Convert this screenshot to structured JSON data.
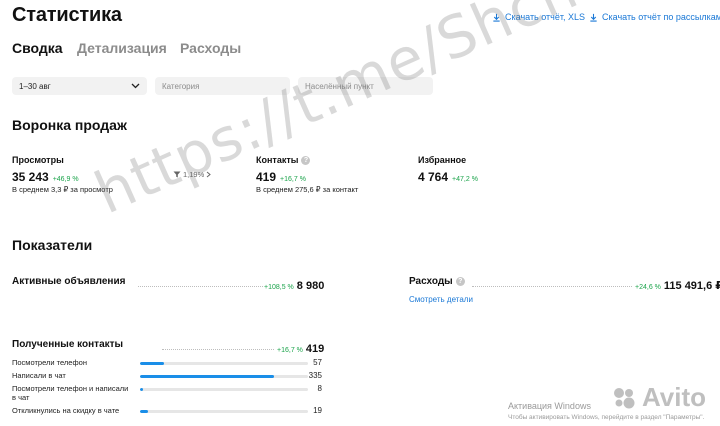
{
  "header": {
    "title": "Статистика",
    "download_report": "Скачать отчёт, XLS",
    "download_mailing_report": "Скачать отчёт по рассылкам, XLS"
  },
  "tabs": [
    {
      "label": "Сводка",
      "active": true
    },
    {
      "label": "Детализация",
      "active": false
    },
    {
      "label": "Расходы",
      "active": false
    }
  ],
  "filters": {
    "period": "1–30 авг",
    "category_placeholder": "Категория",
    "city_placeholder": "Населённый пункт"
  },
  "funnel": {
    "title": "Воронка продаж",
    "views": {
      "label": "Просмотры",
      "value": "35 243",
      "delta": "+46,9 %",
      "sub": "В среднем 3,3 ₽ за просмотр"
    },
    "conversion": "1,19%",
    "contacts": {
      "label": "Контакты",
      "value": "419",
      "delta": "+16,7 %",
      "sub": "В среднем 275,6 ₽ за контакт"
    },
    "favorites": {
      "label": "Избранное",
      "value": "4 764",
      "delta": "+47,2 %"
    }
  },
  "indicators": {
    "title": "Показатели",
    "active_ads": {
      "label": "Активные объявления",
      "delta": "+108,5 %",
      "value": "8 980"
    },
    "expenses": {
      "label": "Расходы",
      "delta": "+24,6 %",
      "value": "115 491,6 ₽",
      "link": "Смотреть детали"
    },
    "received_contacts": {
      "label": "Полученные контакты",
      "delta": "+16,7 %",
      "value": "419",
      "rows": [
        {
          "label": "Посмотрели телефон",
          "value": "57",
          "fraction": 0.14
        },
        {
          "label": "Написали в чат",
          "value": "335",
          "fraction": 0.8
        },
        {
          "label": "Посмотрели телефон и написали в чат",
          "value": "8",
          "fraction": 0.02
        },
        {
          "label": "Откликнулись на скидку в чате",
          "value": "19",
          "fraction": 0.05
        }
      ]
    }
  },
  "overlay": {
    "watermark": "https://t.me/Shchapova_T",
    "windows_activation": "Активация Windows",
    "windows_activation_sub": "Чтобы активировать Windows, перейдите в раздел \"Параметры\".",
    "avito_logo": "Avito"
  },
  "colors": {
    "accent": "#1a78d6",
    "positive": "#1aa34a",
    "bar": "#1a8ee8"
  }
}
